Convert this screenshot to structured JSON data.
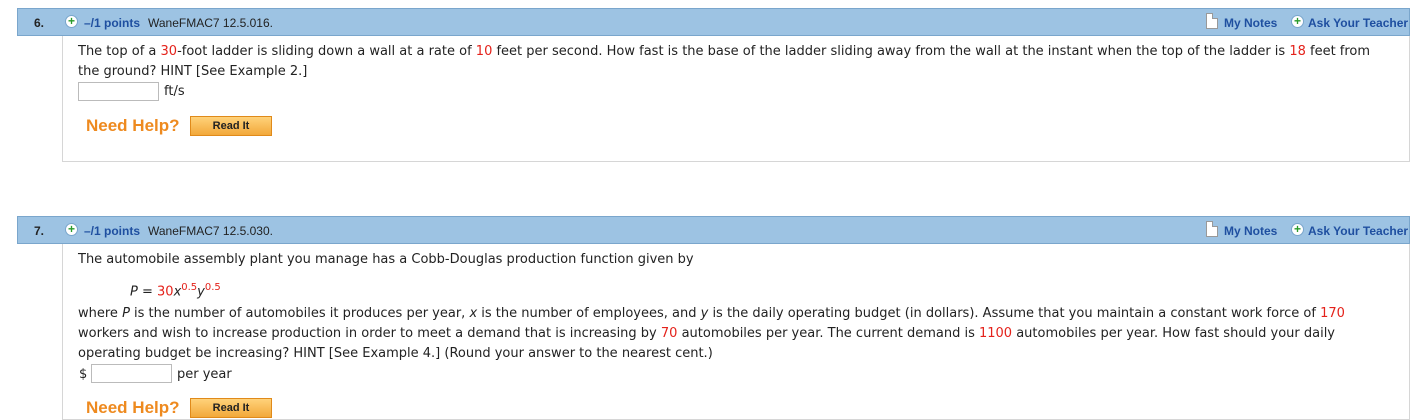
{
  "q6": {
    "number": "6.",
    "points": "–/1 points",
    "code": "WaneFMAC7 12.5.016.",
    "my_notes": "My Notes",
    "ask_teacher": "Ask Your Teacher",
    "line1_a": "The top of a ",
    "v_ladder": "30",
    "line1_b": "-foot ladder is sliding down a wall at a rate of ",
    "v_rate": "10",
    "line1_c": " feet per second. How fast is the base of the ladder sliding away from the wall at the instant when the top of the ladder is ",
    "v_height": "18",
    "line1_d": " feet from",
    "line2": "the ground? HINT [See Example 2.]",
    "unit": "ft/s",
    "answer_value": "",
    "need_help": "Need Help?",
    "read_it": "Read It"
  },
  "q7": {
    "number": "7.",
    "points": "–/1 points",
    "code": "WaneFMAC7 12.5.030.",
    "my_notes": "My Notes",
    "ask_teacher": "Ask Your Teacher",
    "intro": "The automobile assembly plant you manage has a Cobb-Douglas production function given by",
    "formula_lhs": "P",
    "formula_eq": " = ",
    "formula_coef": "30",
    "formula_x": "x",
    "formula_xexp": "0.5",
    "formula_y": "y",
    "formula_yexp": "0.5",
    "l1_where": "where ",
    "l1_P": "P",
    "l1_a": " is the number of automobiles it produces per year, ",
    "l1_x": "x",
    "l1_b": " is the number of employees, and ",
    "l1_y": "y",
    "l1_c": " is the daily operating budget (in dollars). Assume that you maintain a constant work force of ",
    "v_workers": "170",
    "l2_a": "workers and wish to increase production in order to meet a demand that is increasing by ",
    "v_increase": "70",
    "l2_b": " automobiles per year. The current demand is ",
    "v_demand": "1100",
    "l2_c": " automobiles per year. How fast should your daily",
    "l3": "operating budget be increasing? HINT [See Example 4.] (Round your answer to the nearest cent.)",
    "currency": "$",
    "unit": "per year",
    "answer_value": "",
    "need_help": "Need Help?",
    "read_it": "Read It"
  }
}
